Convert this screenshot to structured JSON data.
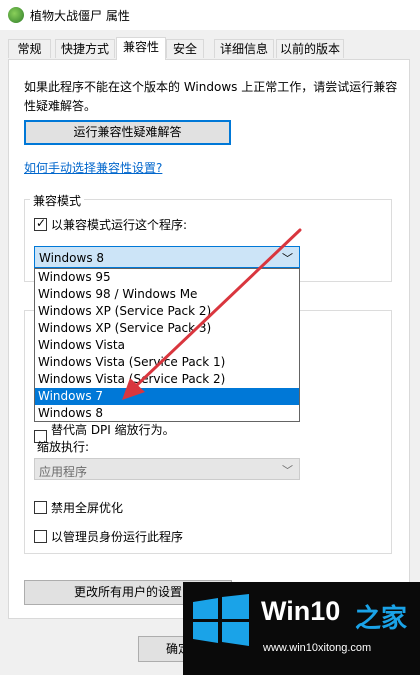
{
  "window": {
    "title": "植物大战僵尸 属性"
  },
  "tabs": [
    {
      "label": "常规"
    },
    {
      "label": "快捷方式"
    },
    {
      "label": "兼容性"
    },
    {
      "label": "安全"
    },
    {
      "label": "详细信息"
    },
    {
      "label": "以前的版本"
    }
  ],
  "compat": {
    "description": "如果此程序不能在这个版本的 Windows 上正常工作，请尝试运行兼容性疑难解答。",
    "troubleshoot_button": "运行兼容性疑难解答",
    "manual_link": "如何手动选择兼容性设置?",
    "mode_group_title": "兼容模式",
    "run_in_mode_label": "以兼容模式运行这个程序:",
    "run_in_mode_checked": true,
    "selected_os": "Windows 8",
    "os_options": [
      "Windows 95",
      "Windows 98 / Windows Me",
      "Windows XP (Service Pack 2)",
      "Windows XP (Service Pack 3)",
      "Windows Vista",
      "Windows Vista (Service Pack 1)",
      "Windows Vista (Service Pack 2)",
      "Windows 7",
      "Windows 8"
    ],
    "highlighted_option": "Windows 7"
  },
  "settings": {
    "dpi_override_label": "替代高 DPI 缩放行为。",
    "scaling_label": "缩放执行:",
    "scaling_select_value": "应用程序",
    "disable_fullscreen_opt_label": "禁用全屏优化",
    "run_as_admin_label": "以管理员身份运行此程序",
    "change_all_users_button": "更改所有用户的设置"
  },
  "footer": {
    "ok_partial": "确定"
  },
  "watermark": {
    "brand": "Win10",
    "brand_suffix": "之家",
    "url": "www.win10xitong.com"
  },
  "colors": {
    "accent": "#0078d7",
    "link": "#0066cc",
    "arrow": "#d9363e"
  }
}
